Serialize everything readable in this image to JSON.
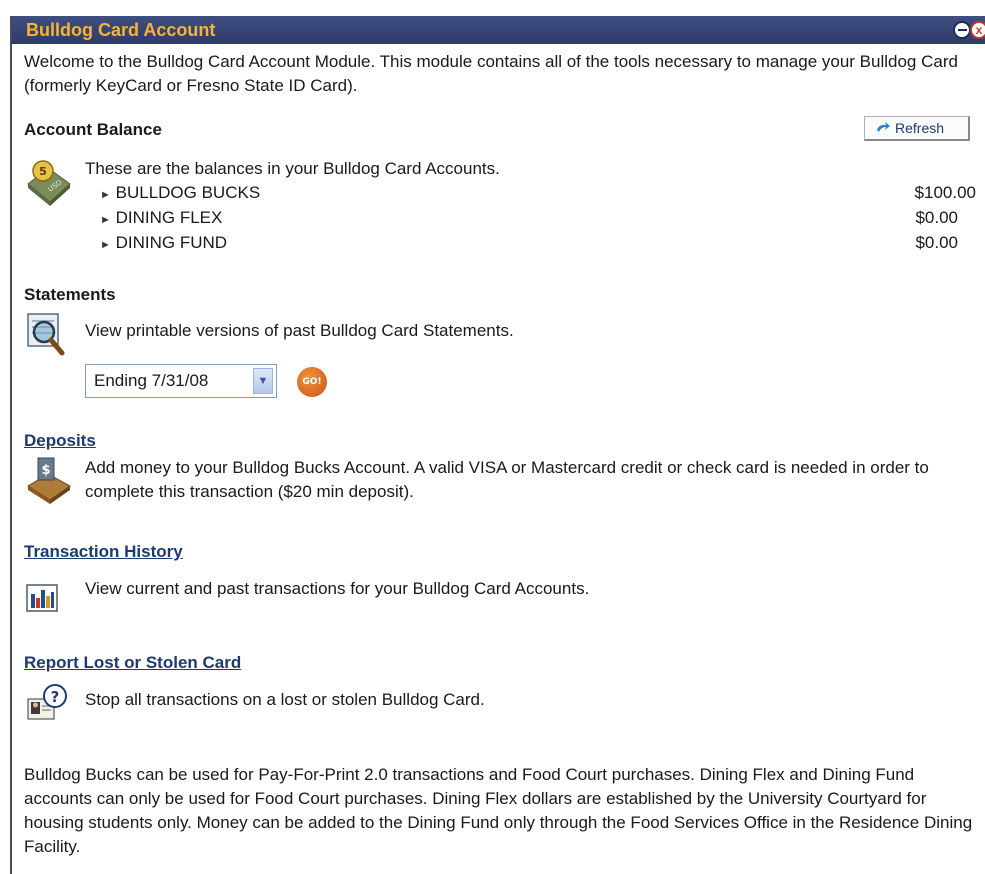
{
  "window": {
    "title": "Bulldog Card Account",
    "close_glyph": "x"
  },
  "intro": {
    "text": "Welcome to the Bulldog Card Account Module. This module contains all of the tools necessary to manage your Bulldog Card (formerly KeyCard or Fresno State ID Card)."
  },
  "balance": {
    "heading": "Account Balance",
    "refresh_label": "Refresh",
    "description": "These are the balances in your Bulldog Card Accounts.",
    "icon_badge": "5",
    "accounts": [
      {
        "name": "BULLDOG BUCKS",
        "amount": "$100.00"
      },
      {
        "name": "DINING FLEX",
        "amount": "$0.00"
      },
      {
        "name": "DINING FUND",
        "amount": "$0.00"
      }
    ]
  },
  "statements": {
    "heading": "Statements",
    "description": "View printable versions of past Bulldog Card Statements.",
    "selected": "Ending 7/31/08",
    "go_label": "GO!"
  },
  "deposits": {
    "heading": "Deposits",
    "description": "Add money to your Bulldog Bucks Account. A valid VISA or Mastercard credit or check card is needed in order to complete this transaction ($20 min deposit).",
    "icon_badge": "$"
  },
  "history": {
    "heading": "Transaction History",
    "description": "View current and past transactions for your Bulldog Card Accounts."
  },
  "lost": {
    "heading": "Report Lost or Stolen Card",
    "description": "Stop all transactions on a lost or stolen Bulldog Card.",
    "icon_badge": "?"
  },
  "footer": {
    "text": "Bulldog Bucks can be used for Pay-For-Print 2.0 transactions and Food Court purchases. Dining Flex and Dining Fund accounts can only be used for Food Court purchases. Dining Flex dollars are established by the University Courtyard for housing students only. Money can be added to the Dining Fund only through the Food Services Office in the Residence Dining Facility."
  },
  "colors": {
    "titlebar": "#34427a",
    "title_text": "#f6b431",
    "link": "#1f3a6e"
  }
}
